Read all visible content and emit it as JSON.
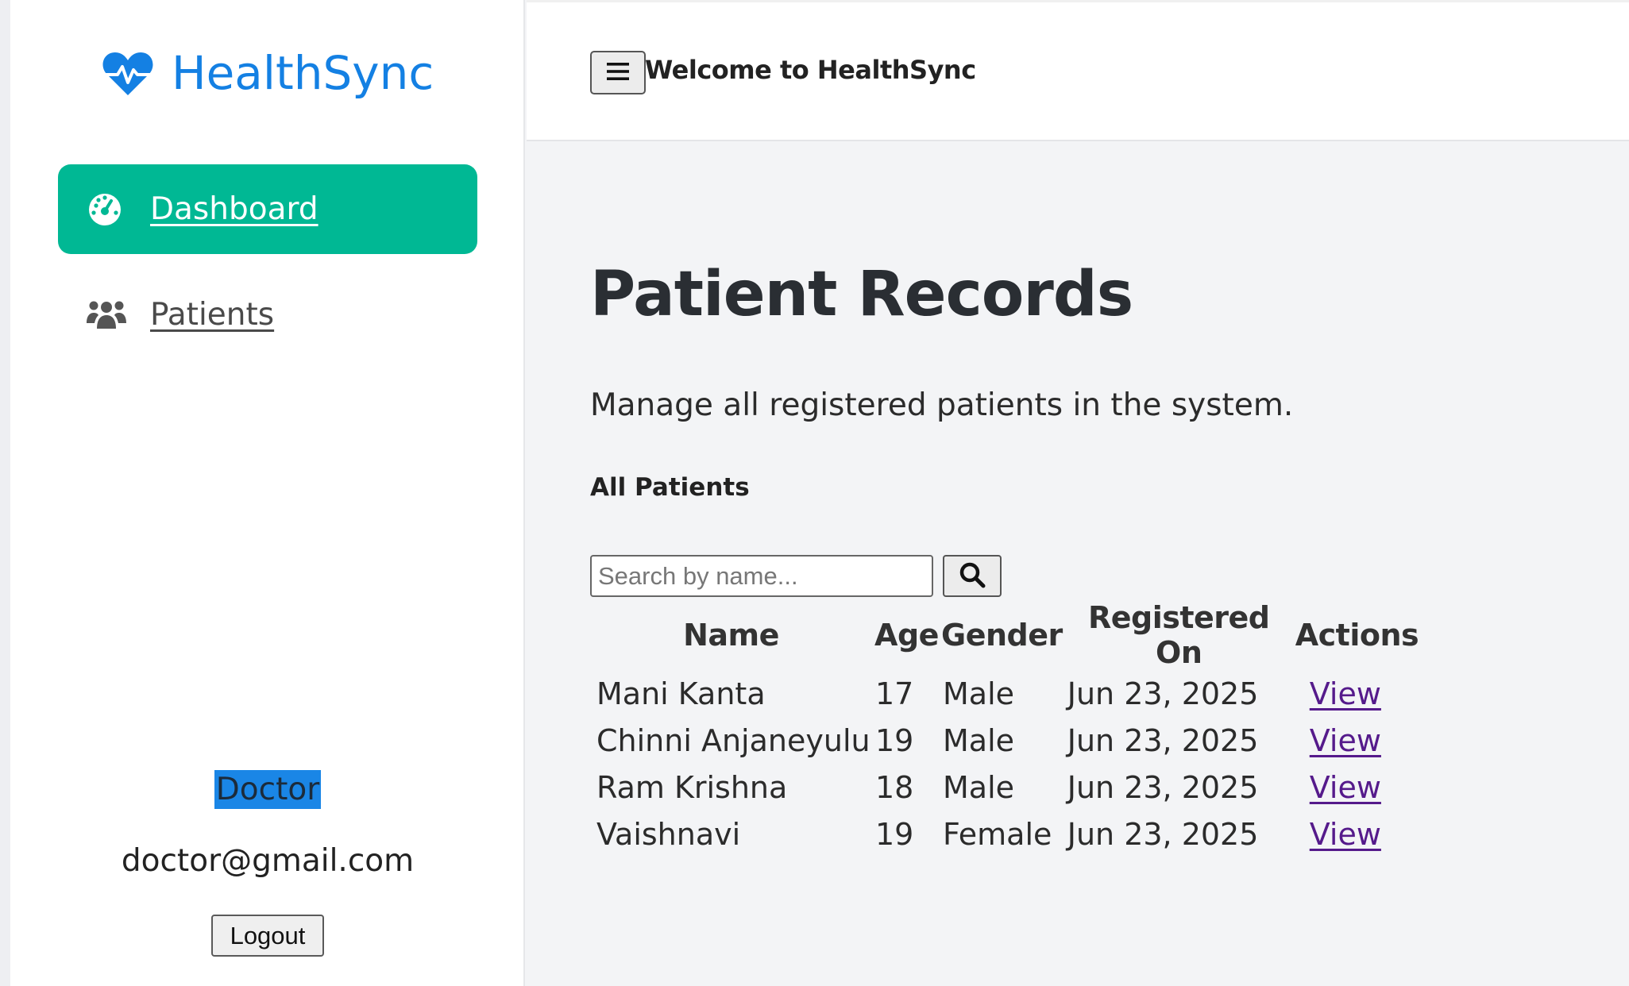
{
  "brand": {
    "name": "HealthSync",
    "accent": "#1480e3"
  },
  "sidebar": {
    "items": [
      {
        "label": "Dashboard",
        "icon": "gauge-icon",
        "active": true
      },
      {
        "label": "Patients",
        "icon": "users-icon",
        "active": false
      }
    ],
    "active_color": "#00b894",
    "user": {
      "role": "Doctor",
      "email": "doctor@gmail.com"
    },
    "logout_label": "Logout"
  },
  "header": {
    "menu_icon": "hamburger-icon",
    "welcome": "Welcome to HealthSync"
  },
  "main": {
    "title": "Patient Records",
    "subtitle": "Manage all registered patients in the system.",
    "section_title": "All Patients",
    "search": {
      "placeholder": "Search by name...",
      "value": "",
      "button_icon": "search-icon"
    },
    "table": {
      "headers": [
        "Name",
        "Age",
        "Gender",
        "Registered On",
        "Actions"
      ],
      "rows": [
        {
          "name": "Mani Kanta",
          "age": "17",
          "gender": "Male",
          "registered_on": "Jun 23, 2025",
          "action": "View"
        },
        {
          "name": "Chinni Anjaneyulu",
          "age": "19",
          "gender": "Male",
          "registered_on": "Jun 23, 2025",
          "action": "View"
        },
        {
          "name": "Ram Krishna",
          "age": "18",
          "gender": "Male",
          "registered_on": "Jun 23, 2025",
          "action": "View"
        },
        {
          "name": "Vaishnavi",
          "age": "19",
          "gender": "Female",
          "registered_on": "Jun 23, 2025",
          "action": "View"
        }
      ]
    }
  }
}
